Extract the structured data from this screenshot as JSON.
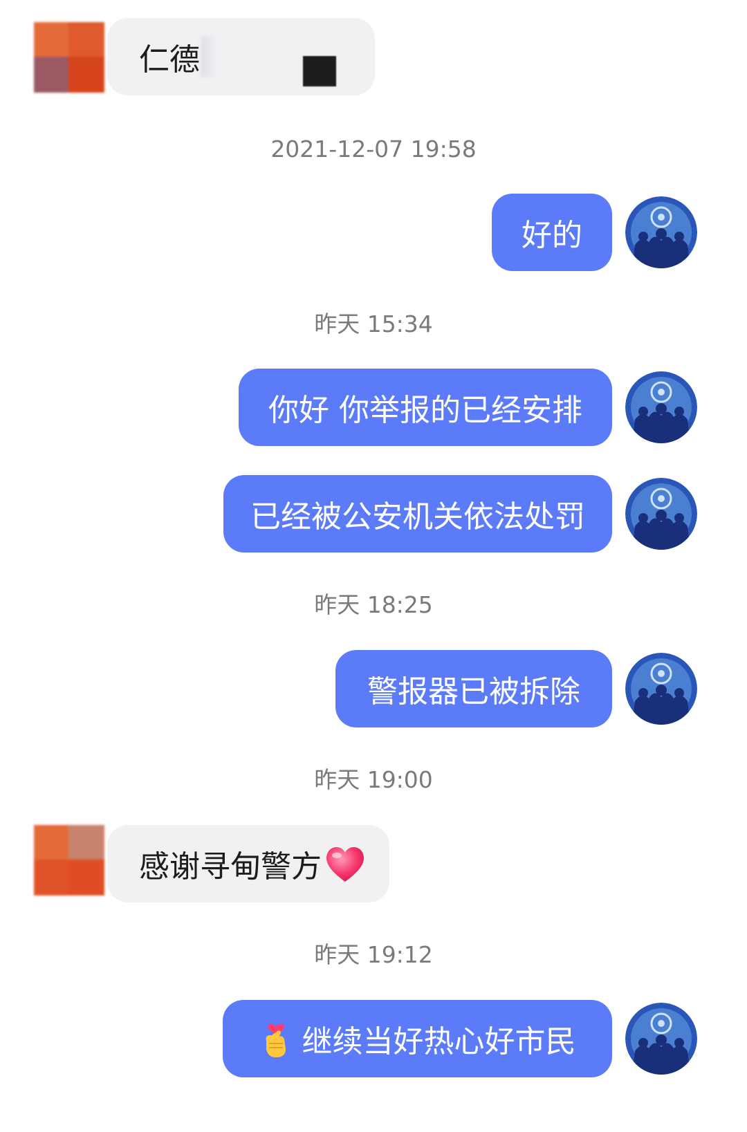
{
  "conversation": {
    "user_messages": [
      {
        "text": "仁德"
      },
      {
        "text": "感谢寻甸警方",
        "emoji": "❤"
      }
    ],
    "timestamps": [
      "2021-12-07 19:58",
      "昨天 15:34",
      "昨天 18:25",
      "昨天 19:00",
      "昨天 19:12"
    ],
    "official_messages": [
      {
        "text": "好的"
      },
      {
        "text": "你好 你举报的已经安排"
      },
      {
        "text": "已经被公安机关依法处罚"
      },
      {
        "text": "警报器已被拆除"
      },
      {
        "text": "继续当好热心好市民",
        "emoji": "🫰"
      }
    ]
  },
  "colors": {
    "outgoing_bubble": "#5b7bf9",
    "incoming_bubble": "#f1f1f4",
    "timestamp_text": "#7a7a7a",
    "avatar_user": "#e0532a",
    "avatar_police": "#2a56b8"
  },
  "icons": {
    "user_avatar": "user-avatar-pixelated",
    "police_avatar": "police-avatar-emblem",
    "heart": "heart-icon",
    "finger_heart": "finger-heart-icon",
    "redaction": "redaction-block"
  }
}
